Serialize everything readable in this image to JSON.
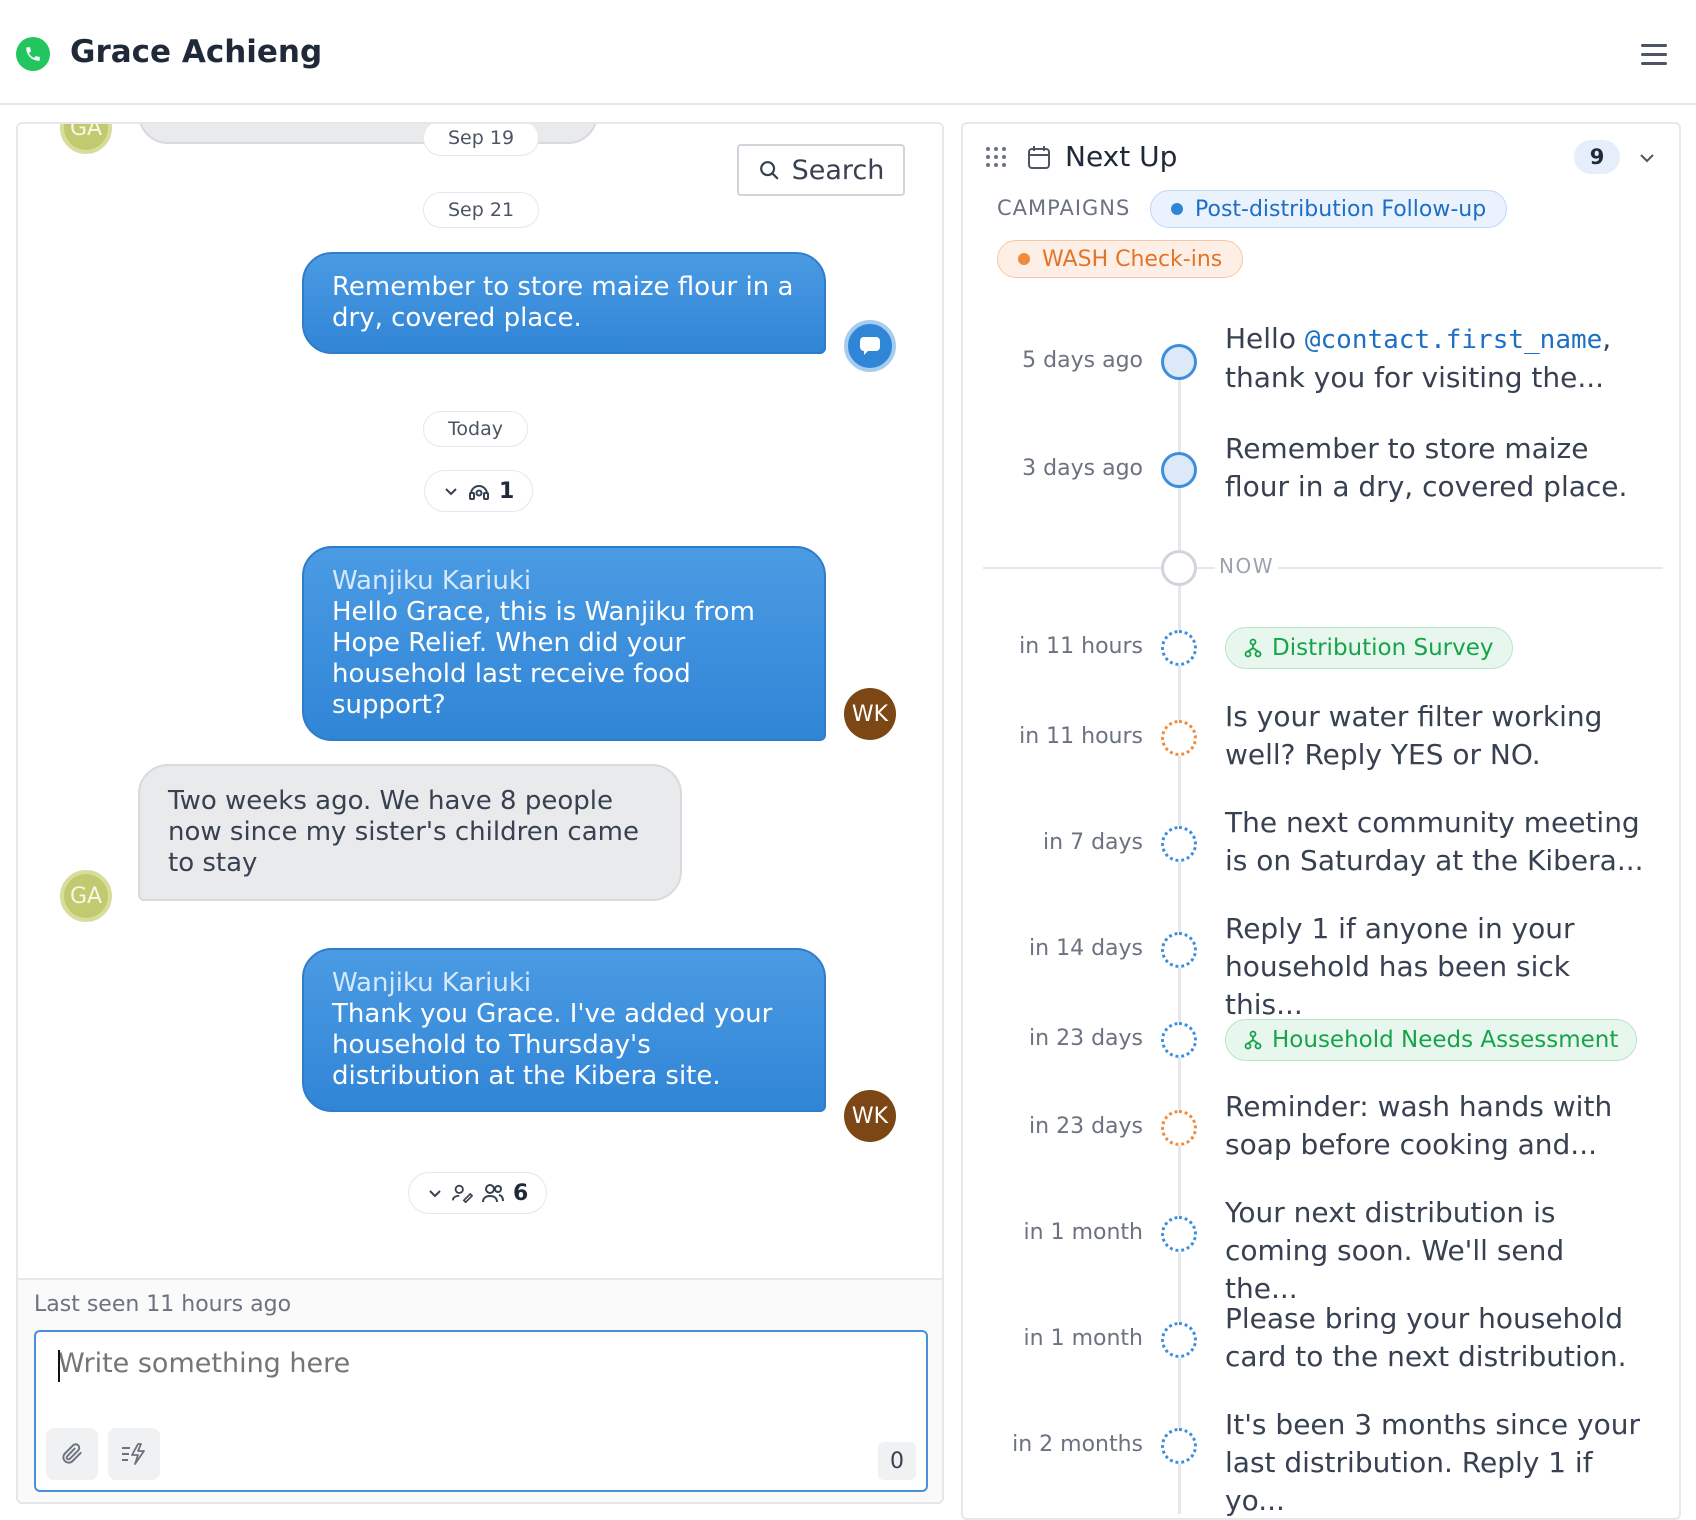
{
  "header": {
    "contact_name": "Grace Achieng"
  },
  "chat": {
    "search_label": "Search",
    "dates": [
      "Sep 19",
      "Sep 21",
      "Today"
    ],
    "messages": [
      {
        "direction": "out",
        "sender": "",
        "text": "Remember to store maize flour in a dry, covered place.",
        "avatar": "bot"
      },
      {
        "direction": "out",
        "sender": "Wanjiku Kariuki",
        "text": "Hello Grace, this is Wanjiku from Hope Relief. When did your household last receive food support?",
        "avatar": "WK"
      },
      {
        "direction": "in",
        "sender": "",
        "text": "Two weeks ago. We have 8 people now since my sister's children came to stay",
        "avatar": "GA"
      },
      {
        "direction": "out",
        "sender": "Wanjiku Kariuki",
        "text": "Thank you Grace. I've added your household to Thursday's distribution at the Kibera site.",
        "avatar": "WK"
      }
    ],
    "avatars": {
      "contact": "GA",
      "agent": "WK"
    },
    "counters": [
      {
        "count": "1"
      },
      {
        "count": "6"
      }
    ],
    "last_seen": "Last seen 11 hours ago",
    "composer": {
      "placeholder": "Write something here",
      "char_count": "0"
    }
  },
  "next_up": {
    "title": "Next Up",
    "count": "9",
    "campaigns_label": "CAMPAIGNS",
    "campaigns": [
      {
        "name": "Post-distribution Follow-up",
        "color": "#2f86d6"
      },
      {
        "name": "WASH Check-ins",
        "color": "#f08a3c"
      }
    ],
    "now_label": "NOW",
    "events": [
      {
        "time": "5 days ago",
        "type": "past",
        "text_prefix": "Hello ",
        "text_var": "@contact.first_name",
        "text_suffix": ",",
        "text_line2": "thank you for visiting the..."
      },
      {
        "time": "3 days ago",
        "type": "past",
        "text": "Remember to store maize flour in a dry, covered place."
      },
      {
        "time": "in 11 hours",
        "type": "flow",
        "text": "Distribution Survey"
      },
      {
        "time": "in 11 hours",
        "type": "orange",
        "text": "Is your water filter working well? Reply YES or NO."
      },
      {
        "time": "in 7 days",
        "type": "blue",
        "text": "The next community meeting is on Saturday at the Kibera..."
      },
      {
        "time": "in 14 days",
        "type": "blue",
        "text": "Reply 1 if anyone in your household has been sick this..."
      },
      {
        "time": "in 23 days",
        "type": "flow",
        "text": "Household Needs Assessment"
      },
      {
        "time": "in 23 days",
        "type": "orange",
        "text": "Reminder: wash hands with soap before cooking and..."
      },
      {
        "time": "in 1 month",
        "type": "blue",
        "text": "Your next distribution is coming soon. We'll send the..."
      },
      {
        "time": "in 1 month",
        "type": "blue",
        "text": "Please bring your household card to the next distribution."
      },
      {
        "time": "in 2 months",
        "type": "blue",
        "text": "It's been 3 months since your last distribution. Reply 1 if yo..."
      }
    ]
  }
}
